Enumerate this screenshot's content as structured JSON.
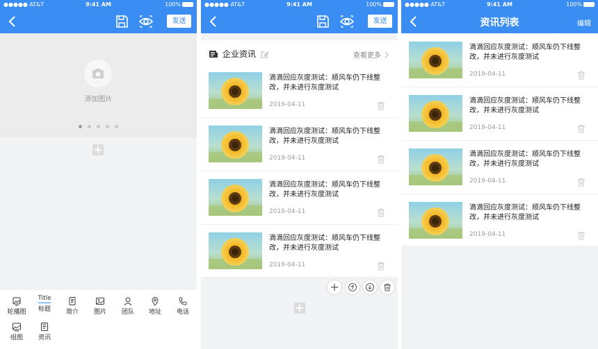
{
  "status": {
    "carrier": "●●●●● AT&T",
    "time": "9:41 AM",
    "battery": "100%"
  },
  "colors": {
    "accent": "#3a8ef3",
    "background": "#f2f3f5"
  },
  "editor_a": {
    "send_label": "发送",
    "add_image_label": "添加图片",
    "carousel_dots": 5,
    "carousel_active_dot": 1,
    "toolbar": [
      {
        "label": "轮播图",
        "icon": "carousel-icon"
      },
      {
        "label": "标题",
        "icon": "title-icon",
        "word": "Title"
      },
      {
        "label": "简介",
        "icon": "intro-icon"
      },
      {
        "label": "图片",
        "icon": "image-icon"
      },
      {
        "label": "团队",
        "icon": "team-icon"
      },
      {
        "label": "地址",
        "icon": "location-icon"
      },
      {
        "label": "电话",
        "icon": "phone-icon"
      },
      {
        "label": "组图",
        "icon": "gallery-icon"
      },
      {
        "label": "资讯",
        "icon": "news-icon"
      }
    ]
  },
  "editor_b": {
    "send_label": "发送",
    "section_title": "企业资讯",
    "see_more": "查看更多",
    "items": [
      {
        "title": "滴滴回应灰度测试：顺风车仍下线整改，并未进行灰度测试",
        "date": "2019-04-11"
      },
      {
        "title": "滴滴回应灰度测试：顺风车仍下线整改，并未进行灰度测试",
        "date": "2019-04-11"
      },
      {
        "title": "滴滴回应灰度测试：顺风车仍下线整改，并未进行灰度测试",
        "date": "2019-04-11"
      },
      {
        "title": "滴滴回应灰度测试：顺风车仍下线整改，并未进行灰度测试",
        "date": "2019-04-11"
      }
    ]
  },
  "news_list": {
    "title": "资讯列表",
    "edit_label": "编辑",
    "items": [
      {
        "title": "滴滴回应灰度测试：顺风车仍下线整改，并未进行灰度测试",
        "date": "2019-04-11"
      },
      {
        "title": "滴滴回应灰度测试：顺风车仍下线整改，并未进行灰度测试",
        "date": "2019-04-11"
      },
      {
        "title": "滴滴回应灰度测试：顺风车仍下线整改，并未进行灰度测试",
        "date": "2019-04-11"
      },
      {
        "title": "滴滴回应灰度测试：顺风车仍下线整改，并未进行灰度测试",
        "date": "2019-04-11"
      }
    ]
  }
}
